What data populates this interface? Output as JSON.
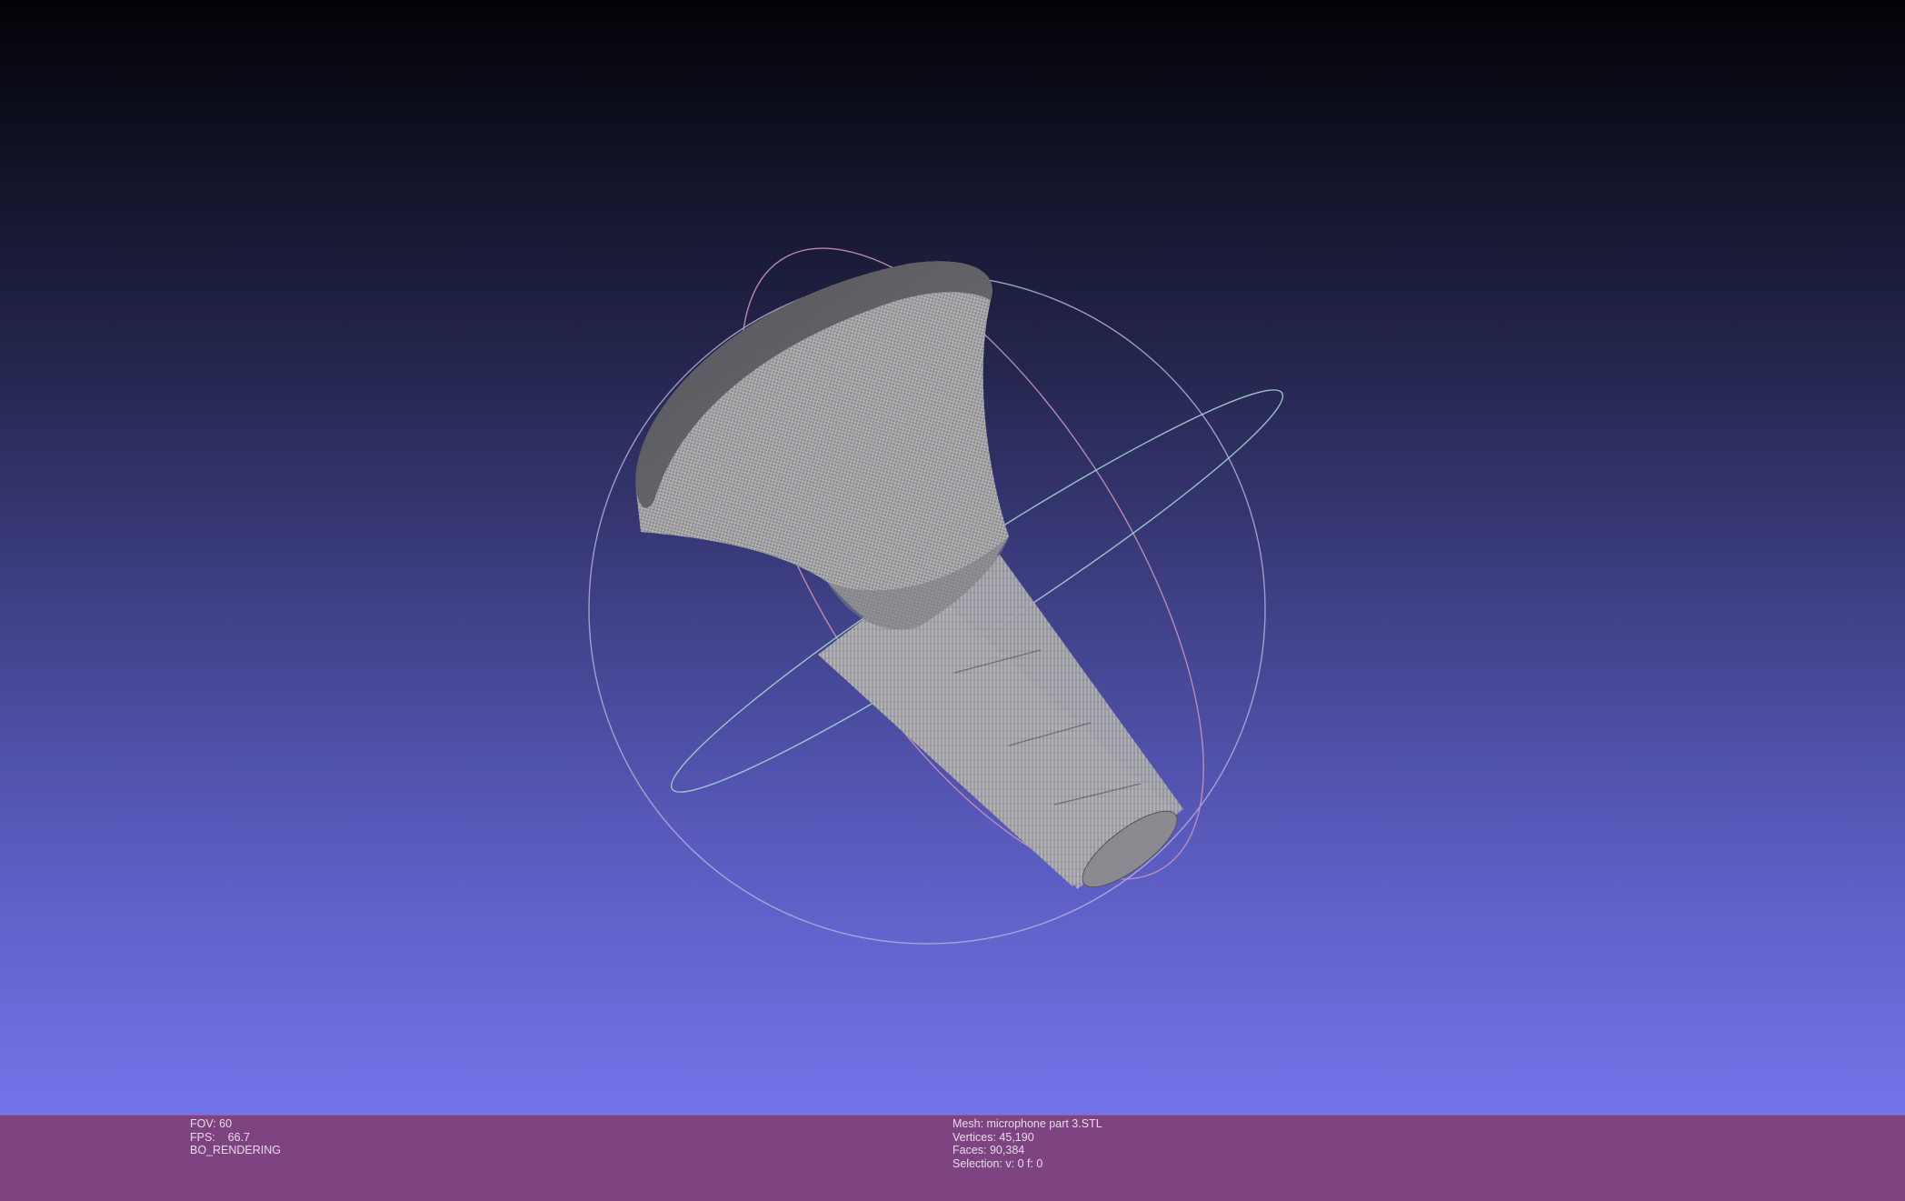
{
  "viewer": {
    "background_top": "#030306",
    "background_bottom": "#7474ea",
    "mesh_color": "#9a9a9a",
    "trackball_colors": {
      "x_ring": "#c792b6",
      "y_ring": "#a7d4d2",
      "z_ring": "#b4aed8"
    }
  },
  "info_left": {
    "fov": "FOV: 60",
    "fps": "FPS:    66.7",
    "render_mode": "BO_RENDERING"
  },
  "info_right": {
    "mesh": "Mesh: microphone part 3.STL",
    "vertices": "Vertices: 45,190",
    "faces": "Faces: 90,384",
    "selection": "Selection: v: 0 f: 0"
  }
}
